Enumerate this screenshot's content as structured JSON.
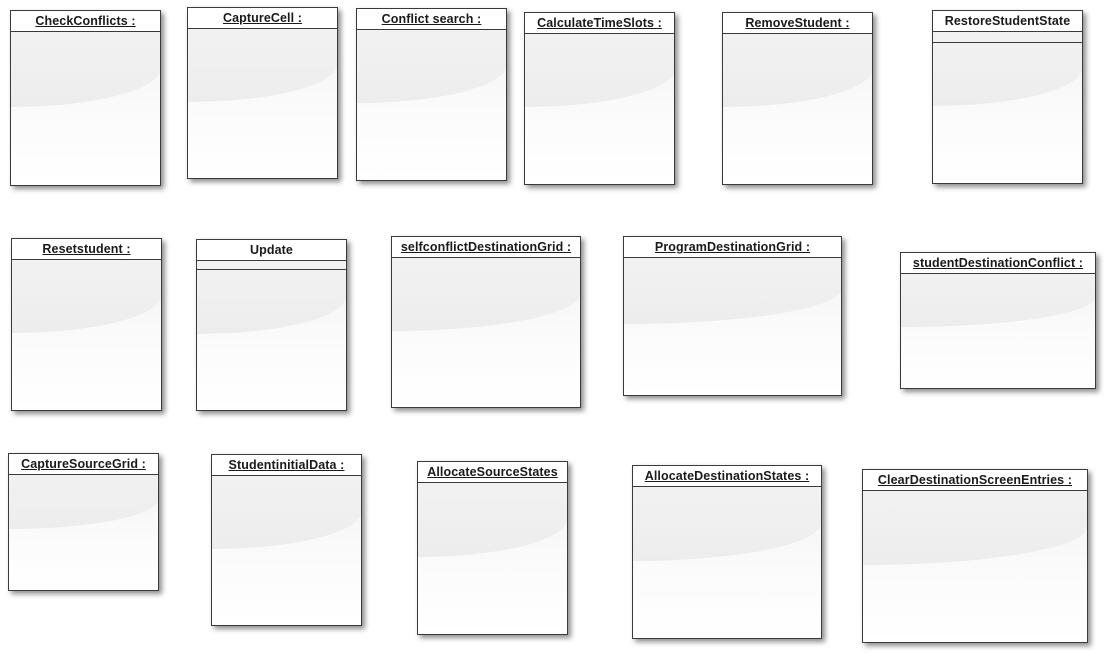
{
  "diagram": {
    "objects": [
      {
        "id": "check-conflicts",
        "label": "CheckConflicts :"
      },
      {
        "id": "capture-cell",
        "label": "CaptureCell :"
      },
      {
        "id": "conflict-search",
        "label": "Conflict search :"
      },
      {
        "id": "calculate-time-slots",
        "label": "CalculateTimeSlots :"
      },
      {
        "id": "remove-student",
        "label": "RemoveStudent :"
      },
      {
        "id": "restore-student-state",
        "label": "RestoreStudentState"
      },
      {
        "id": "reset-student",
        "label": "Resetstudent :"
      },
      {
        "id": "update",
        "label": "Update"
      },
      {
        "id": "selfconflict-destination-grid",
        "label": "selfconflictDestinationGrid :"
      },
      {
        "id": "program-destination-grid",
        "label": "ProgramDestinationGrid :"
      },
      {
        "id": "student-destination-conflict",
        "label": "studentDestinationConflict :"
      },
      {
        "id": "capture-source-grid",
        "label": "CaptureSourceGrid :"
      },
      {
        "id": "student-initial-data",
        "label": "StudentinitialData  :"
      },
      {
        "id": "allocate-source-states",
        "label": "AllocateSourceStates"
      },
      {
        "id": "allocate-destination-states",
        "label": "AllocateDestinationStates :"
      },
      {
        "id": "clear-destination-screen-entries",
        "label": "ClearDestinationScreenEntries :"
      }
    ]
  }
}
